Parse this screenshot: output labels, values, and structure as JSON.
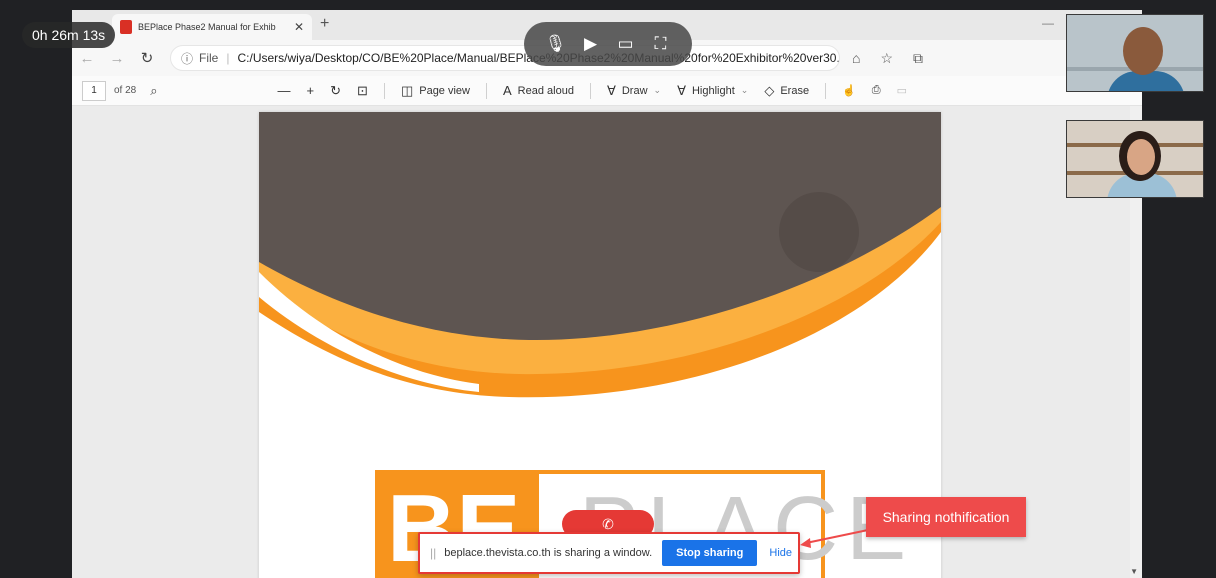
{
  "overlay": {
    "timer": "0h 26m 13s"
  },
  "browser": {
    "tab_title": "BEPlace Phase2 Manual for Exhib",
    "tab_close": "✕",
    "new_tab": "+",
    "back": "←",
    "forward": "→",
    "reload": "↻",
    "url_info": "ⓘ",
    "url_scheme": "File",
    "url_sep": "|",
    "url": "C:/Users/wiya/Desktop/CO/BE%20Place/Manual/BEPlace%20Phase2%20Manual%20for%20Exhibitor%20ver30.9.2..."
  },
  "pdf_toolbar": {
    "page_number": "1",
    "page_total": "of 28",
    "page_view": "Page view",
    "read_aloud": "Read aloud",
    "draw": "Draw",
    "highlight": "Highlight",
    "erase": "Erase"
  },
  "document": {
    "logo_left": "BE",
    "logo_right": "PLACE"
  },
  "sharing": {
    "grip": "||",
    "message": "beplace.thevista.co.th is sharing a window.",
    "stop_label": "Stop sharing",
    "hide_label": "Hide"
  },
  "annotation": {
    "label": "Sharing nothification"
  },
  "colors": {
    "accent_orange": "#f7941d",
    "brown": "#5e5551",
    "callout_red": "#ee4b4b",
    "stop_blue": "#1a73e8"
  }
}
